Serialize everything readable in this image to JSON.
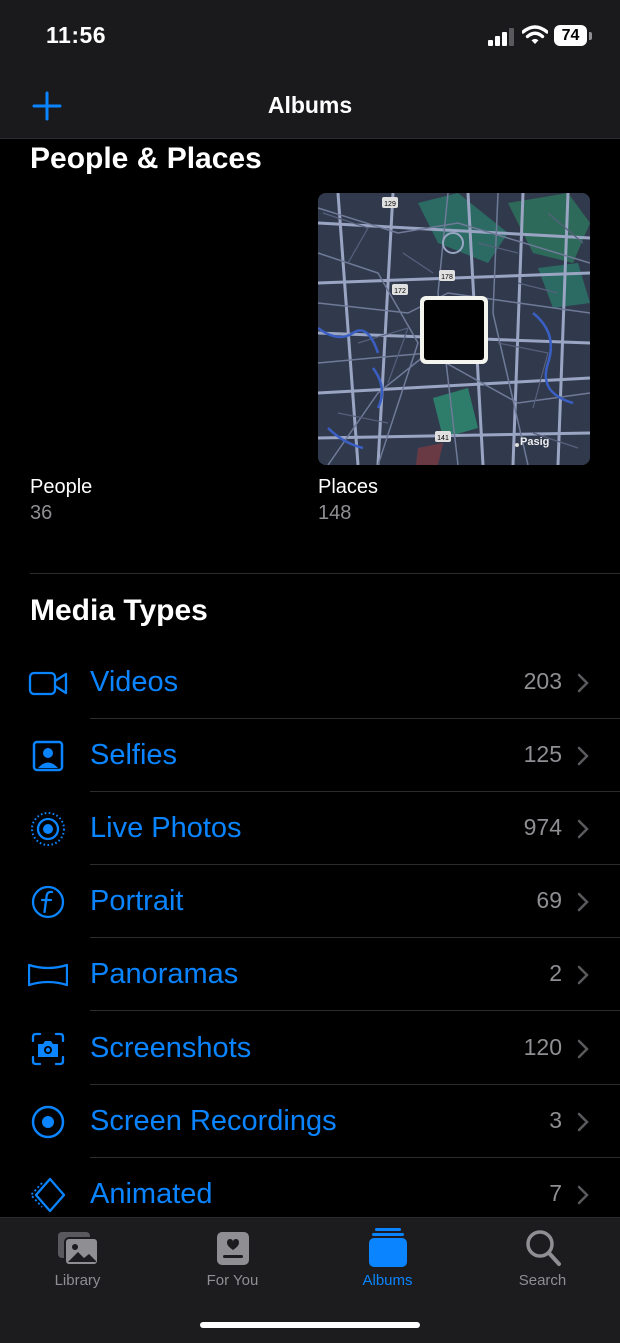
{
  "status": {
    "time": "11:56",
    "battery": "74"
  },
  "nav": {
    "title": "Albums"
  },
  "people_places": {
    "title": "People & Places",
    "people": {
      "label": "People",
      "count": "36"
    },
    "places": {
      "label": "Places",
      "count": "148",
      "map_labels": [
        "129",
        "178",
        "172",
        "141",
        "Pasig"
      ]
    }
  },
  "media_types": {
    "title": "Media Types",
    "items": [
      {
        "label": "Videos",
        "count": "203",
        "icon": "video-icon"
      },
      {
        "label": "Selfies",
        "count": "125",
        "icon": "selfie-icon"
      },
      {
        "label": "Live Photos",
        "count": "974",
        "icon": "live-photo-icon"
      },
      {
        "label": "Portrait",
        "count": "69",
        "icon": "portrait-icon"
      },
      {
        "label": "Panoramas",
        "count": "2",
        "icon": "panorama-icon"
      },
      {
        "label": "Screenshots",
        "count": "120",
        "icon": "screenshot-icon"
      },
      {
        "label": "Screen Recordings",
        "count": "3",
        "icon": "screen-recording-icon"
      },
      {
        "label": "Animated",
        "count": "7",
        "icon": "animated-icon"
      }
    ]
  },
  "tabs": [
    {
      "label": "Library",
      "icon": "library-icon",
      "active": false
    },
    {
      "label": "For You",
      "icon": "for-you-icon",
      "active": false
    },
    {
      "label": "Albums",
      "icon": "albums-icon",
      "active": true
    },
    {
      "label": "Search",
      "icon": "search-icon",
      "active": false
    }
  ],
  "colors": {
    "accent": "#0a84ff",
    "secondary_text": "#8e8e93",
    "background": "#000000"
  }
}
